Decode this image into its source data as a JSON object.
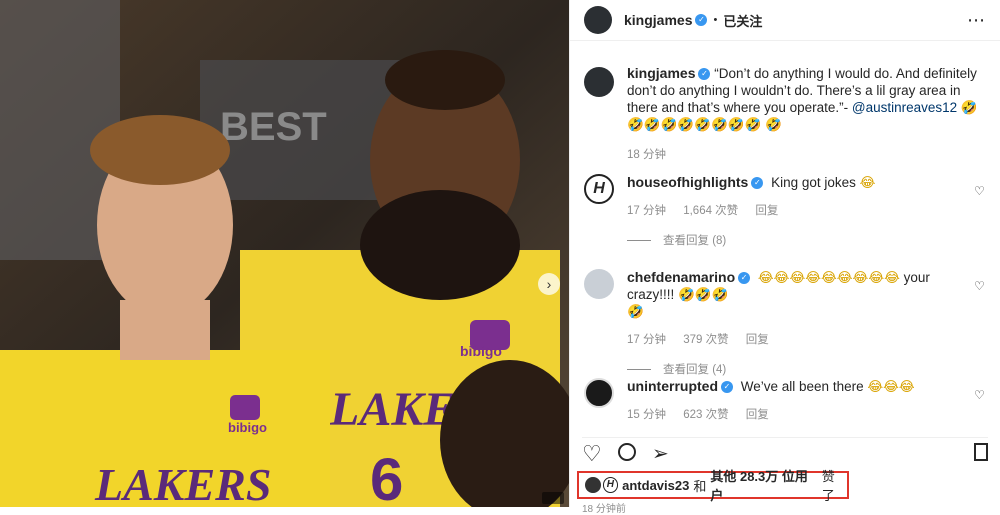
{
  "post_header": {
    "username": "kingjames",
    "separator": "•",
    "follow_status": "已关注",
    "more_icon": "more-horizontal-icon"
  },
  "caption": {
    "username": "kingjames",
    "text": "“Don’t do anything I would do. And definitely don’t do anything I wouldn’t do. There’s a lil gray area in there and that’s where you operate.”- ",
    "mention": "@austinreaves12",
    "emojis_line1": "🤣🤣🤣🤣🤣🤣🤣🤣🤣",
    "emojis_line2": "🤣",
    "time": "18 分钟"
  },
  "comments": [
    {
      "username": "houseofhighlights",
      "text": "King got jokes",
      "emoji": "😂",
      "time": "17 分钟",
      "likes": "1,664 次赞",
      "reply": "回复",
      "view_replies": "查看回复 (8)"
    },
    {
      "username": "chefdenamarino",
      "emoji_prefix": "😂😂😂😂😂😂😂😂😂",
      "text": " your crazy!!!! ",
      "emoji_suffix": "🤣🤣🤣",
      "emoji_line2": "🤣",
      "time": "17 分钟",
      "likes": "379 次赞",
      "reply": "回复",
      "view_replies": "查看回复 (4)"
    },
    {
      "username": "uninterrupted",
      "text": "We’ve all been there",
      "emoji": "😂😂😂",
      "time": "15 分钟",
      "likes": "623 次赞",
      "reply": "回复"
    }
  ],
  "likes_line": {
    "user": "antdavis23",
    "and": "和",
    "others": "其他 28.3万 位用户",
    "liked": "赞了"
  },
  "post_time": "18 分钟前",
  "photo": {
    "patch_text": "bibigo",
    "jersey_text": "LAKERS",
    "wall_text": "BEST",
    "number": "6"
  },
  "colors": {
    "verified": "#3897f0",
    "highlight_box": "#e0352b",
    "mention": "#00376b",
    "jersey": "#f2d52a"
  }
}
